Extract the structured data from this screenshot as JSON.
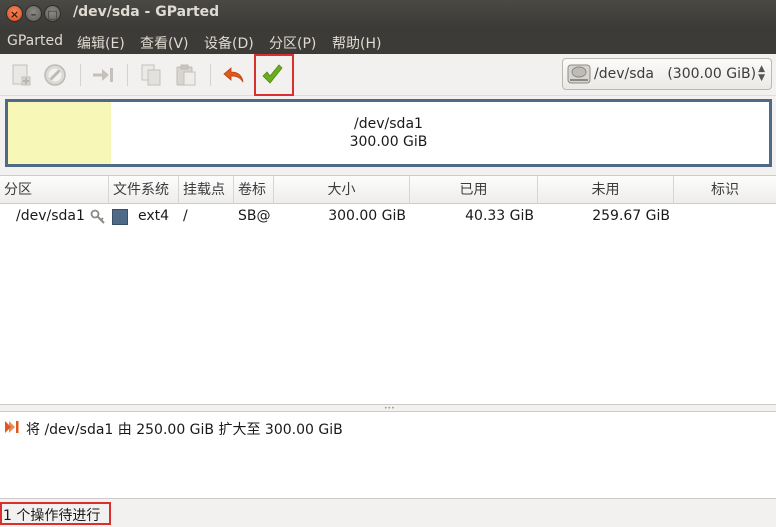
{
  "window": {
    "title": "/dev/sda - GParted"
  },
  "menubar": {
    "items": [
      {
        "label": "GParted"
      },
      {
        "label": "编辑(E)"
      },
      {
        "label": "查看(V)"
      },
      {
        "label": "设备(D)"
      },
      {
        "label": "分区(P)"
      },
      {
        "label": "帮助(H)"
      }
    ]
  },
  "toolbar": {
    "icons": [
      "new-partition-icon",
      "delete-icon",
      "resize-move-icon",
      "copy-icon",
      "paste-icon",
      "undo-icon",
      "apply-checkmark-icon"
    ],
    "accent_undo": "#e0581c",
    "accent_apply": "#6aad1e",
    "highlight": "#d9302f"
  },
  "device_selector": {
    "value": "/dev/sda   (300.00 GiB)",
    "icon": "hard-disk-icon"
  },
  "disk_map": {
    "partition": "/dev/sda1",
    "size": "300.00 GiB",
    "used_fraction": 0.135,
    "used_color": "#f7f7b8",
    "border_color": "#4f6a87"
  },
  "table": {
    "headers": [
      "分区",
      "文件系统",
      "挂载点",
      "卷标",
      "大小",
      "已用",
      "未用",
      "标识"
    ],
    "rows": [
      {
        "partition": "/dev/sda1",
        "filesystem": "ext4",
        "mountpoint": "/",
        "label": "SB@",
        "size": "300.00 GiB",
        "used": "40.33 GiB",
        "unused": "259.67 GiB",
        "flags": ""
      }
    ]
  },
  "operations": [
    {
      "text": "将 /dev/sda1 由 250.00 GiB 扩大至 300.00 GiB"
    }
  ],
  "status": {
    "text": "1 个操作待进行"
  }
}
